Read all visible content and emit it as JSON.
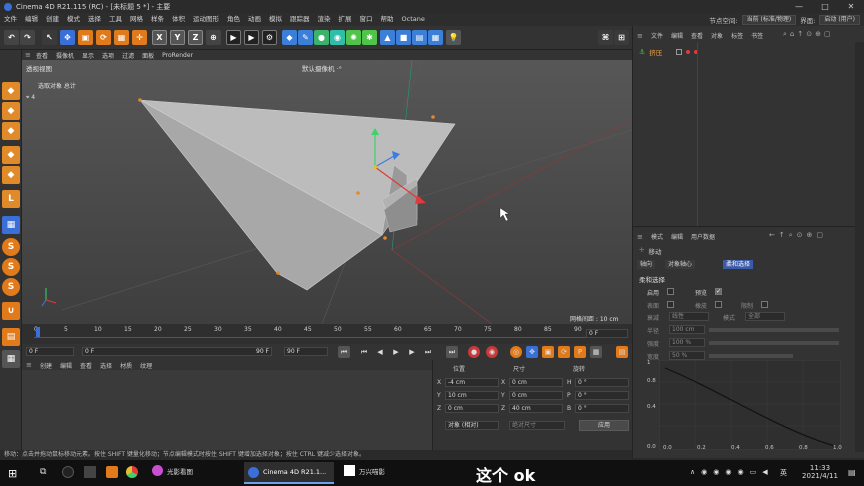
{
  "window": {
    "title": "Cinema 4D R21.115 (RC) - [未标题 5 *] - 主要"
  },
  "menus": [
    "文件",
    "编辑",
    "创建",
    "模式",
    "选择",
    "工具",
    "网格",
    "样条",
    "体积",
    "运动图形",
    "角色",
    "动画",
    "模拟",
    "跟踪器",
    "渲染",
    "扩展",
    "窗口",
    "帮助",
    "Octane"
  ],
  "menu_right": {
    "node_label": "节点空间:",
    "node_value": "当前 (标准/物理)",
    "layout_label": "界面:",
    "layout_value": "启动 (用户)"
  },
  "toolbar": {
    "x_axis": "X",
    "y_axis": "Y",
    "z_axis": "Z"
  },
  "viewport": {
    "menu": [
      "查看",
      "摄像机",
      "显示",
      "选项",
      "过滤",
      "面板",
      "ProRender"
    ],
    "name": "透视视图",
    "camera": "默认摄像机 ·°",
    "selected_label": "选取对象 总计",
    "selected_count": "4",
    "grid_spacing": "网格间距 : 10 cm"
  },
  "timeline": {
    "ticks": [
      "0",
      "5",
      "10",
      "15",
      "20",
      "25",
      "30",
      "35",
      "40",
      "45",
      "50",
      "55",
      "60",
      "65",
      "70",
      "75",
      "80",
      "85",
      "90"
    ],
    "current_frame": "0 F"
  },
  "transport": {
    "start": "0 F",
    "current": "0 F",
    "end": "90 F",
    "end2": "90 F"
  },
  "materials": {
    "menu": [
      "创建",
      "编辑",
      "查看",
      "选择",
      "材质",
      "纹理"
    ]
  },
  "coords": {
    "headers": [
      "位置",
      "尺寸",
      "旋转"
    ],
    "rows": [
      {
        "axis": "X",
        "pos": "-4 cm",
        "size_axis": "X",
        "size": "0 cm",
        "rot_axis": "H",
        "rot": "0 °"
      },
      {
        "axis": "Y",
        "pos": "10 cm",
        "size_axis": "Y",
        "size": "0 cm",
        "rot_axis": "P",
        "rot": "0 °"
      },
      {
        "axis": "Z",
        "pos": "0 cm",
        "size_axis": "Z",
        "size": "40 cm",
        "rot_axis": "B",
        "rot": "0 °"
      }
    ],
    "mode": "对象 (相对)",
    "size_mode": "绝对尺寸",
    "apply": "应用"
  },
  "objects": {
    "menu": [
      "文件",
      "编辑",
      "查看",
      "对象",
      "标签",
      "书签"
    ],
    "item": "挤压"
  },
  "attributes": {
    "menu": [
      "模式",
      "编辑",
      "用户数据"
    ],
    "title": "移动",
    "tabs": [
      "轴向",
      "对象轴心",
      "柔和选择"
    ],
    "section": "柔和选择",
    "fields": [
      {
        "label": "启用",
        "type": "check",
        "checked": false
      },
      {
        "label": "预览",
        "type": "check",
        "checked": true
      },
      {
        "label": "表面",
        "type": "check",
        "checked": false
      },
      {
        "label": "橡皮",
        "type": "check",
        "checked": false
      },
      {
        "label": "限制",
        "type": "check",
        "checked": false
      },
      {
        "label": "衰减",
        "value": "线性"
      },
      {
        "label": "模式",
        "value": "全部"
      },
      {
        "label": "半径",
        "value": "100 cm"
      },
      {
        "label": "强度",
        "value": "100 %"
      },
      {
        "label": "宽度",
        "value": "50 %"
      }
    ],
    "graph_y": [
      "1",
      "0.8",
      "0.4",
      "0.0"
    ],
    "graph_x": [
      "0.0",
      "0.2",
      "0.4",
      "0.6",
      "0.8",
      "1.0"
    ]
  },
  "statusbar": "移动：点击并拖动鼠标移动元素。按住 SHIFT 键量化移动；节点编辑模式时按住 SHIFT 键增加选择对象；按住 CTRL 键减少选择对象。",
  "taskbar": {
    "apps": [
      {
        "label": "光影看图"
      },
      {
        "label": "Cinema 4D R21.1..."
      },
      {
        "label": "万兴喵影"
      }
    ],
    "subtitle": "这个 ok",
    "time": "11:33",
    "date": "2021/4/11",
    "lang": "英"
  },
  "colors": {
    "accent": "#3b6fd8",
    "x_axis": "#e03a3a",
    "y_axis": "#3bd36a",
    "z_axis": "#3a7de0",
    "active_tab": "#3b5aa8"
  }
}
